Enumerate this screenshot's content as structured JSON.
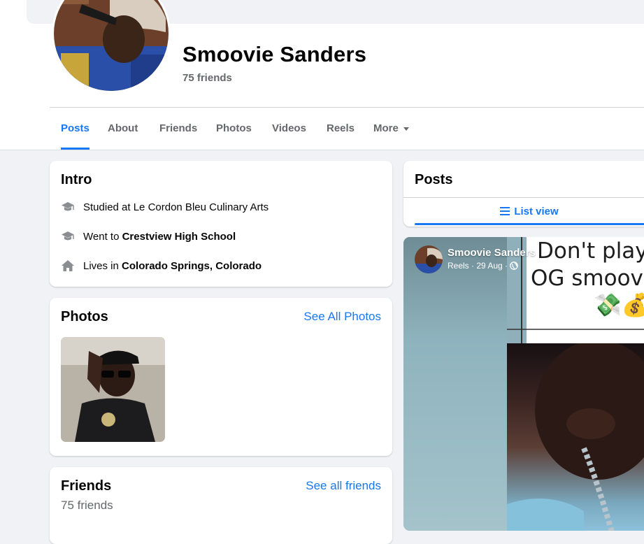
{
  "profile": {
    "name": "Smoovie Sanders",
    "friends_count": "75 friends"
  },
  "tabs": [
    {
      "label": "Posts",
      "active": true
    },
    {
      "label": "About"
    },
    {
      "label": "Friends"
    },
    {
      "label": "Photos"
    },
    {
      "label": "Videos"
    },
    {
      "label": "Reels"
    },
    {
      "label": "More"
    }
  ],
  "intro": {
    "title": "Intro",
    "items": [
      {
        "icon": "graduation-cap-icon",
        "prefix": "Studied at Le Cordon Bleu Culinary Arts",
        "bold": ""
      },
      {
        "icon": "graduation-cap-icon",
        "prefix": "Went to ",
        "bold": "Crestview High School"
      },
      {
        "icon": "home-icon",
        "prefix": "Lives in ",
        "bold": "Colorado Springs, Colorado"
      }
    ]
  },
  "photos": {
    "title": "Photos",
    "see_all": "See All Photos"
  },
  "friends": {
    "title": "Friends",
    "see_all": "See all friends",
    "count": "75 friends"
  },
  "posts": {
    "title": "Posts",
    "list_view": "List view"
  },
  "reel_post": {
    "author": "Smoovie Sanders",
    "meta": "Reels · 29 Aug ·",
    "overlay_line1": "Don't play",
    "overlay_line2": "OG smoov",
    "emoji": "💸💰"
  },
  "colors": {
    "accent": "#1877f2",
    "secondary_text": "#65676b",
    "page_bg": "#f0f2f5"
  }
}
